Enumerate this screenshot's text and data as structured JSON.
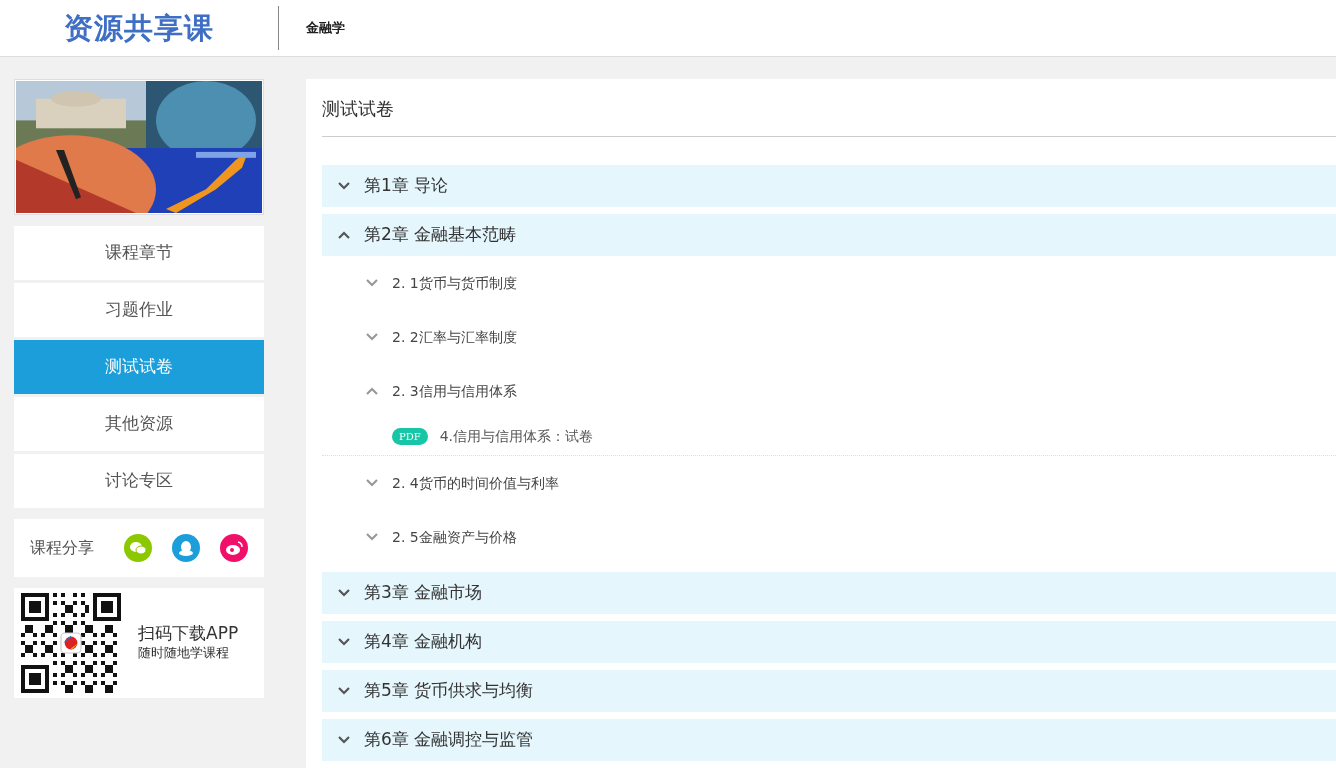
{
  "header": {
    "logo": "资源共享课",
    "course": "金融学"
  },
  "sidebar": {
    "menu": [
      {
        "label": "课程章节",
        "selected": false
      },
      {
        "label": "习题作业",
        "selected": false
      },
      {
        "label": "测试试卷",
        "selected": true
      },
      {
        "label": "其他资源",
        "selected": false
      },
      {
        "label": "讨论专区",
        "selected": false
      }
    ],
    "share": {
      "label": "课程分享",
      "icons": [
        {
          "kind": "wechat",
          "color": "#8cc800"
        },
        {
          "kind": "qq",
          "color": "#1b9ed9"
        },
        {
          "kind": "weibo",
          "color": "#f0106a"
        }
      ]
    },
    "app": {
      "title": "扫码下载APP",
      "subtitle": "随时随地学课程"
    }
  },
  "main": {
    "title": "测试试卷",
    "chapters": [
      {
        "label": "第1章 导论",
        "expanded": false
      },
      {
        "label": "第2章 金融基本范畴",
        "expanded": true,
        "children": [
          {
            "label": "2. 1货币与货币制度",
            "expanded": false
          },
          {
            "label": "2. 2汇率与汇率制度",
            "expanded": false
          },
          {
            "label": "2. 3信用与信用体系",
            "expanded": true,
            "children": [
              {
                "badge": "PDF",
                "label": "4.信用与信用体系：试卷"
              }
            ]
          },
          {
            "label": "2. 4货币的时间价值与利率",
            "expanded": false
          },
          {
            "label": "2. 5金融资产与价格",
            "expanded": false
          }
        ]
      },
      {
        "label": "第3章 金融市场",
        "expanded": false
      },
      {
        "label": "第4章 金融机构",
        "expanded": false
      },
      {
        "label": "第5章 货币供求与均衡",
        "expanded": false
      },
      {
        "label": "第6章 金融调控与监管",
        "expanded": false
      }
    ]
  }
}
